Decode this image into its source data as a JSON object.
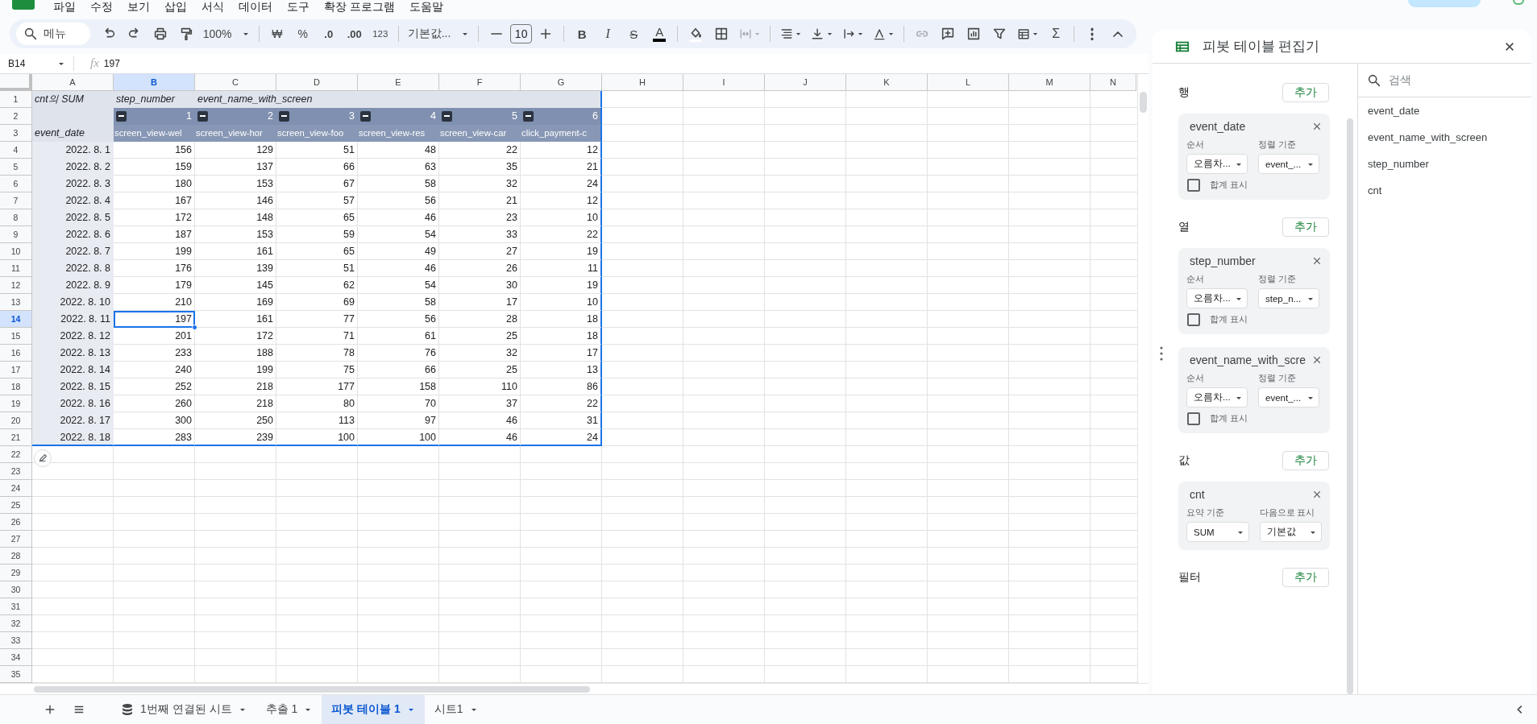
{
  "menu": [
    "파일",
    "수정",
    "보기",
    "삽입",
    "서식",
    "데이터",
    "도구",
    "확장 프로그램",
    "도움말"
  ],
  "toolbar": {
    "search_placeholder": "메뉴",
    "zoom": "100%",
    "currency": "₩",
    "percent": "%",
    "decrease_decimals": ".0",
    "increase_decimals": ".00",
    "number_format": "123",
    "font": "기본값...",
    "font_size": "10",
    "bold": "B",
    "italic": "I",
    "strikethrough": "S",
    "text_color": "A",
    "sum": "Σ"
  },
  "formula_bar": {
    "cell": "B14",
    "fx": "fx",
    "value": "197"
  },
  "columns": [
    {
      "label": "A",
      "selected": false
    },
    {
      "label": "B",
      "selected": true
    },
    {
      "label": "C",
      "selected": false
    },
    {
      "label": "D",
      "selected": false
    },
    {
      "label": "E",
      "selected": false
    },
    {
      "label": "F",
      "selected": false
    },
    {
      "label": "G",
      "selected": false
    },
    {
      "label": "H",
      "selected": false
    },
    {
      "label": "I",
      "selected": false
    },
    {
      "label": "J",
      "selected": false
    },
    {
      "label": "K",
      "selected": false
    },
    {
      "label": "L",
      "selected": false
    },
    {
      "label": "M",
      "selected": false
    },
    {
      "label": "N",
      "selected": false
    }
  ],
  "row_numbers": [
    {
      "label": "1",
      "selected": false
    },
    {
      "label": "2",
      "selected": false
    },
    {
      "label": "3",
      "selected": false
    },
    {
      "label": "4",
      "selected": false
    },
    {
      "label": "5",
      "selected": false
    },
    {
      "label": "6",
      "selected": false
    },
    {
      "label": "7",
      "selected": false
    },
    {
      "label": "8",
      "selected": false
    },
    {
      "label": "9",
      "selected": false
    },
    {
      "label": "10",
      "selected": false
    },
    {
      "label": "11",
      "selected": false
    },
    {
      "label": "12",
      "selected": false
    },
    {
      "label": "13",
      "selected": false
    },
    {
      "label": "14",
      "selected": true
    },
    {
      "label": "15",
      "selected": false
    },
    {
      "label": "16",
      "selected": false
    },
    {
      "label": "17",
      "selected": false
    },
    {
      "label": "18",
      "selected": false
    },
    {
      "label": "19",
      "selected": false
    },
    {
      "label": "20",
      "selected": false
    },
    {
      "label": "21",
      "selected": false
    },
    {
      "label": "22",
      "selected": false
    },
    {
      "label": "23",
      "selected": false
    },
    {
      "label": "24",
      "selected": false
    },
    {
      "label": "25",
      "selected": false
    },
    {
      "label": "26",
      "selected": false
    },
    {
      "label": "27",
      "selected": false
    },
    {
      "label": "28",
      "selected": false
    },
    {
      "label": "29",
      "selected": false
    },
    {
      "label": "30",
      "selected": false
    },
    {
      "label": "31",
      "selected": false
    },
    {
      "label": "32",
      "selected": false
    },
    {
      "label": "33",
      "selected": false
    },
    {
      "label": "34",
      "selected": false
    },
    {
      "label": "35",
      "selected": false
    }
  ],
  "pivot": {
    "corner": "cnt의 SUM",
    "column_fields": [
      "step_number",
      "event_name_with_screen"
    ],
    "steps": [
      "1",
      "2",
      "3",
      "4",
      "5",
      "6"
    ],
    "events": [
      "screen_view-wel",
      "screen_view-hor",
      "screen_view-foo",
      "screen_view-res",
      "screen_view-car",
      "click_payment-c"
    ],
    "row_field": "event_date",
    "rows": [
      {
        "date": "2022. 8. 1",
        "values": [
          "156",
          "129",
          "51",
          "48",
          "22",
          "12"
        ]
      },
      {
        "date": "2022. 8. 2",
        "values": [
          "159",
          "137",
          "66",
          "63",
          "35",
          "21"
        ]
      },
      {
        "date": "2022. 8. 3",
        "values": [
          "180",
          "153",
          "67",
          "58",
          "32",
          "24"
        ]
      },
      {
        "date": "2022. 8. 4",
        "values": [
          "167",
          "146",
          "57",
          "56",
          "21",
          "12"
        ]
      },
      {
        "date": "2022. 8. 5",
        "values": [
          "172",
          "148",
          "65",
          "46",
          "23",
          "10"
        ]
      },
      {
        "date": "2022. 8. 6",
        "values": [
          "187",
          "153",
          "59",
          "54",
          "33",
          "22"
        ]
      },
      {
        "date": "2022. 8. 7",
        "values": [
          "199",
          "161",
          "65",
          "49",
          "27",
          "19"
        ]
      },
      {
        "date": "2022. 8. 8",
        "values": [
          "176",
          "139",
          "51",
          "46",
          "26",
          "11"
        ]
      },
      {
        "date": "2022. 8. 9",
        "values": [
          "179",
          "145",
          "62",
          "54",
          "30",
          "19"
        ]
      },
      {
        "date": "2022. 8. 10",
        "values": [
          "210",
          "169",
          "69",
          "58",
          "17",
          "10"
        ]
      },
      {
        "date": "2022. 8. 11",
        "values": [
          "197",
          "161",
          "77",
          "56",
          "28",
          "18"
        ]
      },
      {
        "date": "2022. 8. 12",
        "values": [
          "201",
          "172",
          "71",
          "61",
          "25",
          "18"
        ]
      },
      {
        "date": "2022. 8. 13",
        "values": [
          "233",
          "188",
          "78",
          "76",
          "32",
          "17"
        ]
      },
      {
        "date": "2022. 8. 14",
        "values": [
          "240",
          "199",
          "75",
          "66",
          "25",
          "13"
        ]
      },
      {
        "date": "2022. 8. 15",
        "values": [
          "252",
          "218",
          "177",
          "158",
          "110",
          "86"
        ]
      },
      {
        "date": "2022. 8. 16",
        "values": [
          "260",
          "218",
          "80",
          "70",
          "37",
          "22"
        ]
      },
      {
        "date": "2022. 8. 17",
        "values": [
          "300",
          "250",
          "113",
          "97",
          "46",
          "31"
        ]
      },
      {
        "date": "2022. 8. 18",
        "values": [
          "283",
          "239",
          "100",
          "100",
          "46",
          "24"
        ]
      }
    ]
  },
  "pivot_editor": {
    "title": "피봇 테이블 편집기",
    "search_placeholder": "검색",
    "sections": [
      {
        "label": "행",
        "add": "추가",
        "cards": [
          {
            "kind": "sort",
            "field": "event_date",
            "options": [
              {
                "label": "순서",
                "value": "오름차..."
              },
              {
                "label": "정렬 기준",
                "value": "event_..."
              }
            ],
            "total": {
              "label": "합계 표시",
              "checked": false
            }
          }
        ]
      },
      {
        "label": "열",
        "add": "추가",
        "cards": [
          {
            "kind": "sort",
            "field": "step_number",
            "options": [
              {
                "label": "순서",
                "value": "오름차..."
              },
              {
                "label": "정렬 기준",
                "value": "step_n..."
              }
            ],
            "total": {
              "label": "합계 표시",
              "checked": false
            }
          },
          {
            "kind": "sort",
            "field": "event_name_with_scre",
            "options": [
              {
                "label": "순서",
                "value": "오름차..."
              },
              {
                "label": "정렬 기준",
                "value": "event_..."
              }
            ],
            "total": {
              "label": "합계 표시",
              "checked": false
            }
          }
        ]
      },
      {
        "label": "값",
        "add": "추가",
        "cards": [
          {
            "kind": "value",
            "field": "cnt",
            "options": [
              {
                "label": "요약 기준",
                "value": "SUM"
              },
              {
                "label": "다음으로 표시",
                "value": "기본값"
              }
            ]
          }
        ]
      },
      {
        "label": "필터",
        "add": "추가"
      }
    ],
    "fields": [
      "event_date",
      "event_name_with_screen",
      "step_number",
      "cnt"
    ]
  },
  "sheet_tabs": [
    {
      "label": "1번째 연결된 시트",
      "kind": "connected",
      "selected": false
    },
    {
      "label": "추출 1",
      "kind": "extract",
      "selected": false
    },
    {
      "label": "피봇 테이블 1",
      "kind": "sheet",
      "selected": true
    },
    {
      "label": "시트1",
      "kind": "sheet",
      "selected": false
    }
  ]
}
